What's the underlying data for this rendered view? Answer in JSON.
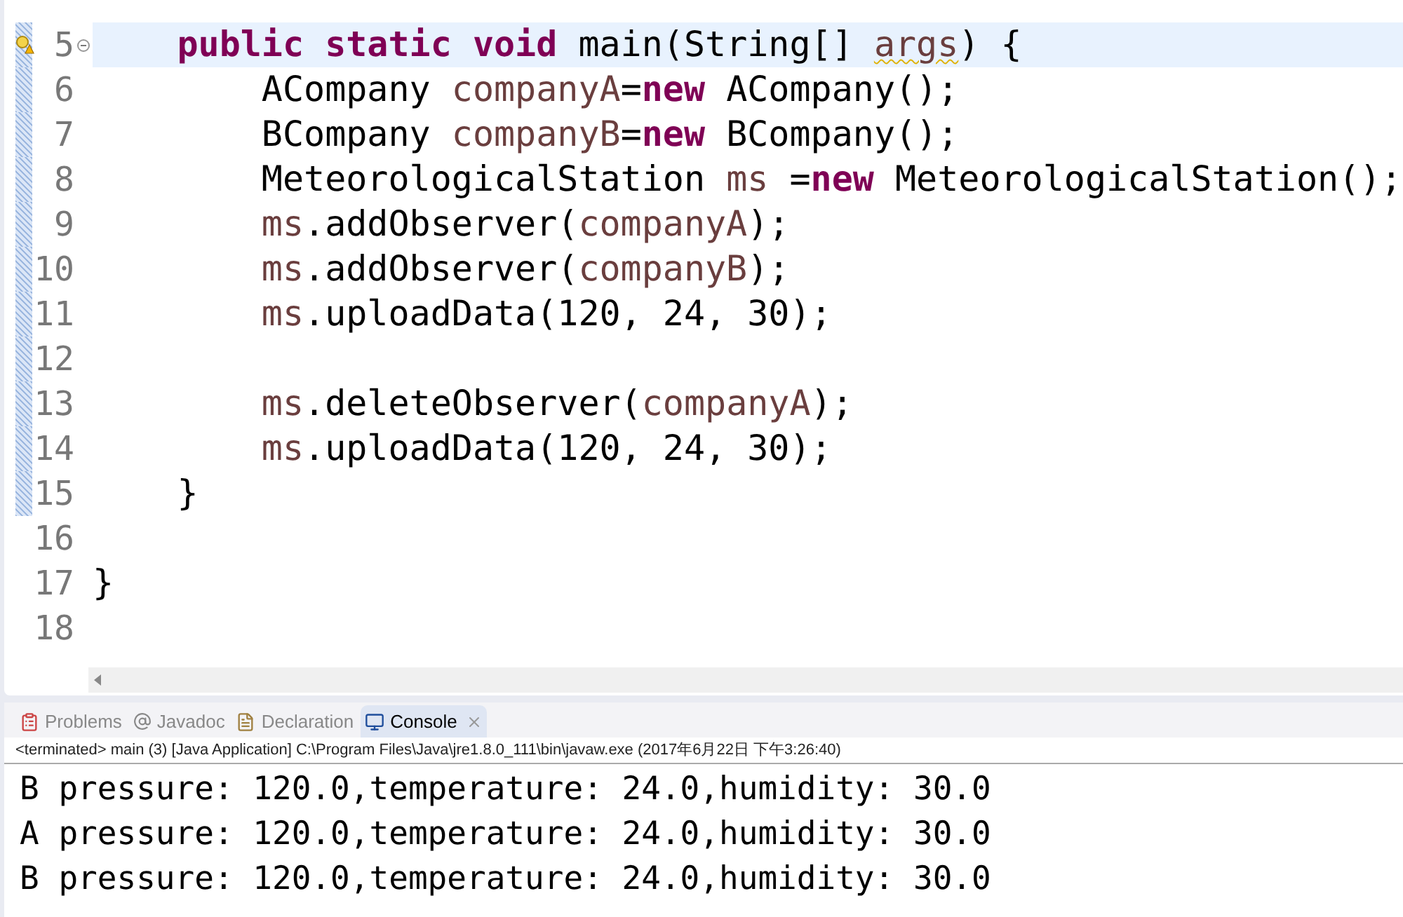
{
  "editor": {
    "lines": [
      {
        "number": "5",
        "current": true,
        "changed": true,
        "warning": true,
        "collapsible": true,
        "tokens": [
          {
            "kind": "keyword",
            "text": "    public "
          },
          {
            "kind": "keyword",
            "text": "static "
          },
          {
            "kind": "keyword",
            "text": "void"
          },
          {
            "kind": "plain",
            "text": " main(String[] "
          },
          {
            "kind": "variable",
            "text": "args",
            "warning": true
          },
          {
            "kind": "plain",
            "text": ") {"
          }
        ]
      },
      {
        "number": "6",
        "current": false,
        "changed": true,
        "warning": false,
        "collapsible": false,
        "tokens": [
          {
            "kind": "plain",
            "text": "        ACompany "
          },
          {
            "kind": "variable",
            "text": "companyA"
          },
          {
            "kind": "plain",
            "text": "="
          },
          {
            "kind": "keyword",
            "text": "new"
          },
          {
            "kind": "plain",
            "text": " ACompany();"
          }
        ]
      },
      {
        "number": "7",
        "current": false,
        "changed": true,
        "warning": false,
        "collapsible": false,
        "tokens": [
          {
            "kind": "plain",
            "text": "        BCompany "
          },
          {
            "kind": "variable",
            "text": "companyB"
          },
          {
            "kind": "plain",
            "text": "="
          },
          {
            "kind": "keyword",
            "text": "new"
          },
          {
            "kind": "plain",
            "text": " BCompany();"
          }
        ]
      },
      {
        "number": "8",
        "current": false,
        "changed": true,
        "warning": false,
        "collapsible": false,
        "tokens": [
          {
            "kind": "plain",
            "text": "        MeteorologicalStation "
          },
          {
            "kind": "variable",
            "text": "ms"
          },
          {
            "kind": "plain",
            "text": " ="
          },
          {
            "kind": "keyword",
            "text": "new"
          },
          {
            "kind": "plain",
            "text": " MeteorologicalStation();"
          }
        ]
      },
      {
        "number": "9",
        "current": false,
        "changed": true,
        "warning": false,
        "collapsible": false,
        "tokens": [
          {
            "kind": "variable",
            "text": "        ms"
          },
          {
            "kind": "plain",
            "text": ".addObserver("
          },
          {
            "kind": "variable",
            "text": "companyA"
          },
          {
            "kind": "plain",
            "text": ");"
          }
        ]
      },
      {
        "number": "10",
        "current": false,
        "changed": true,
        "warning": false,
        "collapsible": false,
        "tokens": [
          {
            "kind": "variable",
            "text": "        ms"
          },
          {
            "kind": "plain",
            "text": ".addObserver("
          },
          {
            "kind": "variable",
            "text": "companyB"
          },
          {
            "kind": "plain",
            "text": ");"
          }
        ]
      },
      {
        "number": "11",
        "current": false,
        "changed": true,
        "warning": false,
        "collapsible": false,
        "tokens": [
          {
            "kind": "variable",
            "text": "        ms"
          },
          {
            "kind": "plain",
            "text": ".uploadData(120, 24, 30);"
          }
        ]
      },
      {
        "number": "12",
        "current": false,
        "changed": true,
        "warning": false,
        "collapsible": false
      },
      {
        "number": "13",
        "current": false,
        "changed": true,
        "warning": false,
        "collapsible": false,
        "tokens": [
          {
            "kind": "variable",
            "text": "        ms"
          },
          {
            "kind": "plain",
            "text": ".deleteObserver("
          },
          {
            "kind": "variable",
            "text": "companyA"
          },
          {
            "kind": "plain",
            "text": ");"
          }
        ]
      },
      {
        "number": "14",
        "current": false,
        "changed": true,
        "warning": false,
        "collapsible": false,
        "tokens": [
          {
            "kind": "variable",
            "text": "        ms"
          },
          {
            "kind": "plain",
            "text": ".uploadData(120, 24, 30);"
          }
        ]
      },
      {
        "number": "15",
        "current": false,
        "changed": true,
        "warning": false,
        "collapsible": false,
        "tokens": [
          {
            "kind": "plain",
            "text": "    }"
          }
        ]
      },
      {
        "number": "16",
        "current": false,
        "changed": false,
        "warning": false,
        "collapsible": false
      },
      {
        "number": "17",
        "current": false,
        "changed": false,
        "warning": false,
        "collapsible": false,
        "tokens": [
          {
            "kind": "plain",
            "text": "}"
          }
        ]
      },
      {
        "number": "18",
        "current": false,
        "changed": false,
        "warning": false,
        "collapsible": false
      }
    ]
  },
  "panel": {
    "tabs": [
      {
        "kind": "problems",
        "label": "Problems",
        "selected": false
      },
      {
        "kind": "javadoc",
        "label": "Javadoc",
        "selected": false
      },
      {
        "kind": "declaration",
        "label": "Declaration",
        "selected": false
      },
      {
        "kind": "console",
        "label": "Console",
        "selected": true
      }
    ],
    "console_header": "<terminated> main (3) [Java Application] C:\\Program Files\\Java\\jre1.8.0_111\\bin\\javaw.exe (2017年6月22日 下午3:26:40)",
    "output": [
      "B pressure: 120.0,temperature: 24.0,humidity: 30.0",
      "A pressure: 120.0,temperature: 24.0,humidity: 30.0",
      "B pressure: 120.0,temperature: 24.0,humidity: 30.0"
    ]
  }
}
